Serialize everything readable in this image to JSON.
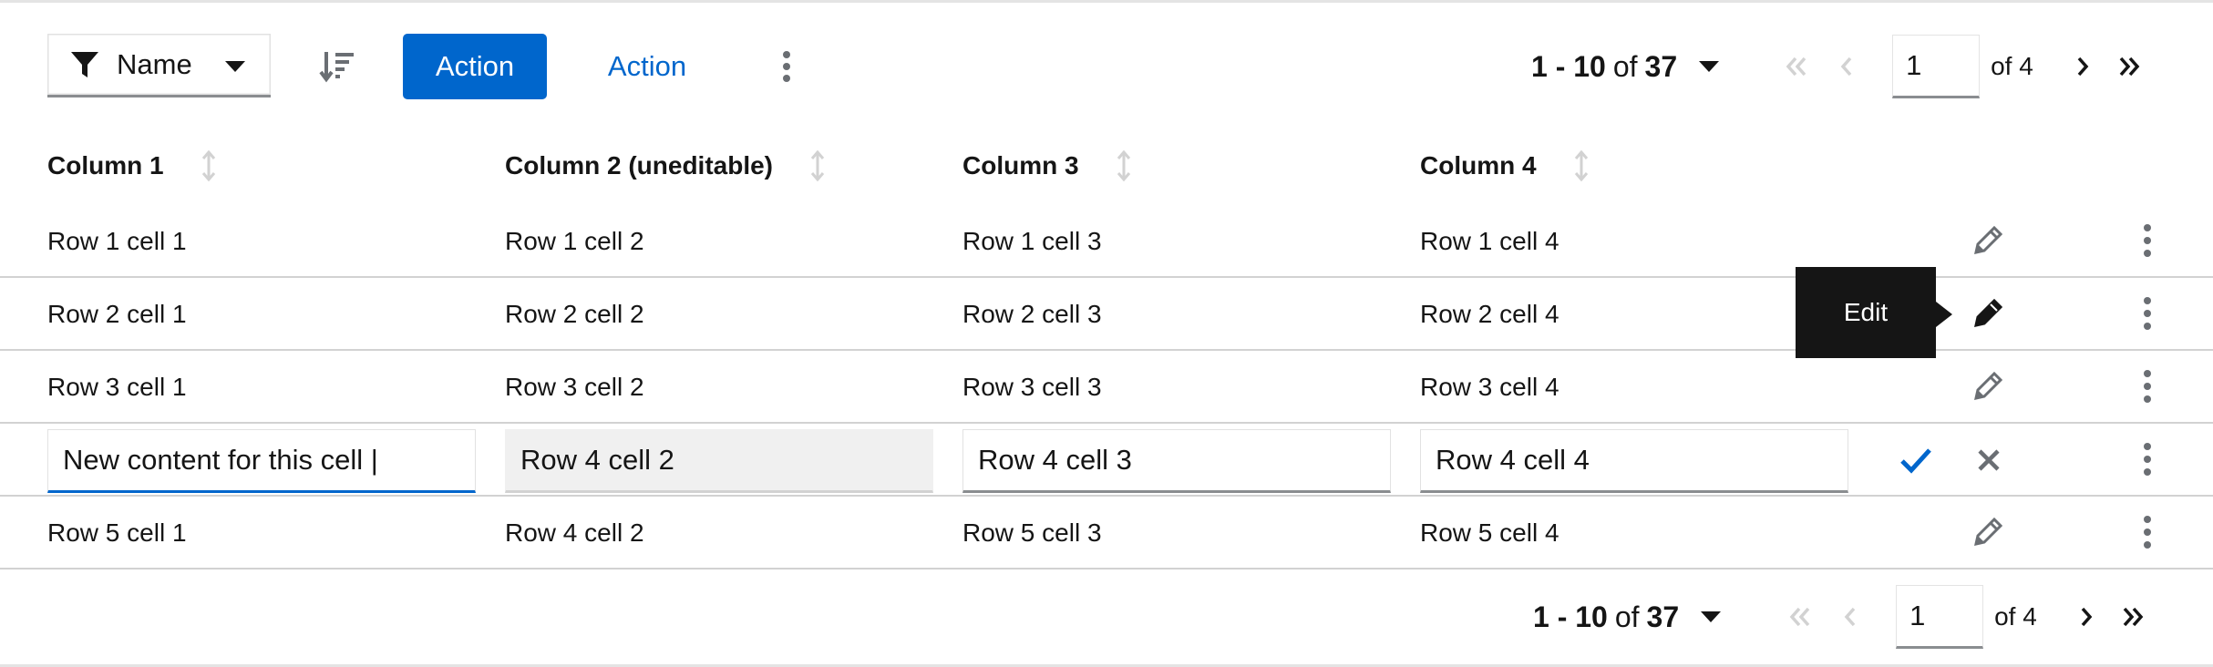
{
  "toolbar": {
    "filter_label": "Name",
    "primary_action": "Action",
    "link_action": "Action"
  },
  "pagination": {
    "range": "1 - 10",
    "of_label": "of",
    "total": "37",
    "current_page": "1",
    "pages_label": "of 4"
  },
  "columns": [
    "Column 1",
    "Column 2 (uneditable)",
    "Column 3",
    "Column 4"
  ],
  "rows": [
    {
      "c1": "Row 1 cell 1",
      "c2": "Row 1 cell 2",
      "c3": "Row 1 cell 3",
      "c4": "Row 1 cell 4"
    },
    {
      "c1": "Row 2 cell 1",
      "c2": "Row 2 cell 2",
      "c3": "Row 2 cell 3",
      "c4": "Row 2 cell 4"
    },
    {
      "c1": "Row 3 cell 1",
      "c2": "Row 3 cell 2",
      "c3": "Row 3 cell 3",
      "c4": "Row 3 cell 4"
    },
    {
      "c1": "New content for this cell |",
      "c2": "Row 4 cell 2",
      "c3": "Row 4 cell 3",
      "c4": "Row 4 cell 4"
    },
    {
      "c1": "Row 5 cell 1",
      "c2": "Row 4 cell 2",
      "c3": "Row 5 cell 3",
      "c4": "Row 5 cell 4"
    }
  ],
  "tooltip": "Edit",
  "colors": {
    "primary": "#0066cc",
    "tooltip_bg": "#151515",
    "disabled_bg": "#f0f0f0"
  }
}
